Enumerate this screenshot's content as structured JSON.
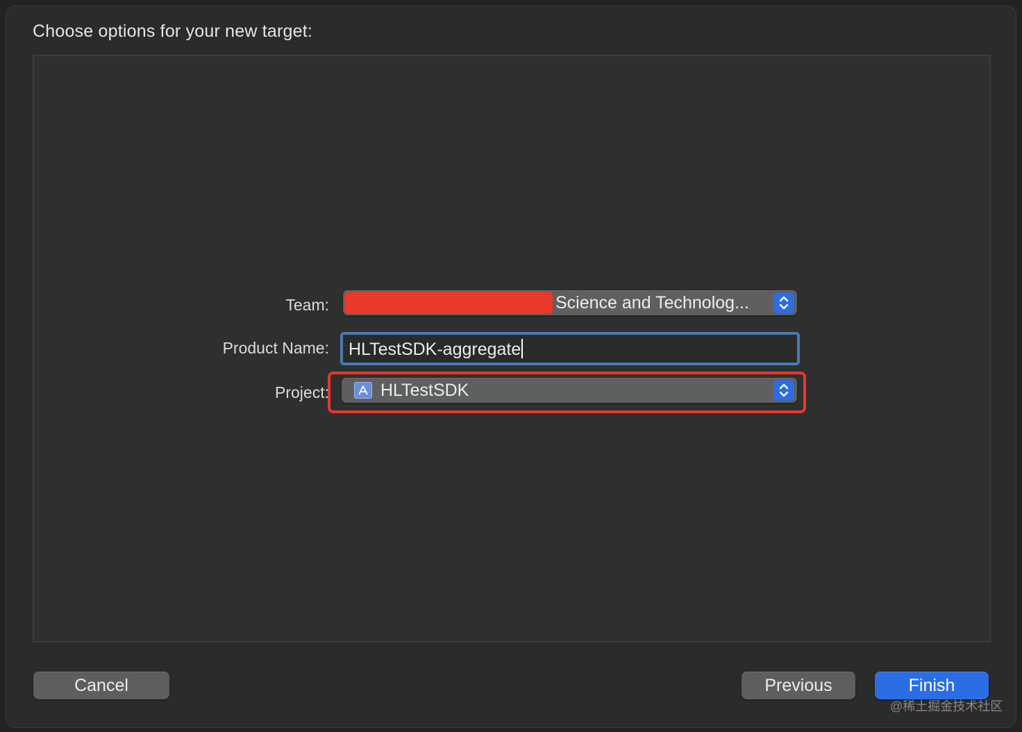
{
  "dialog": {
    "title": "Choose options for your new target:"
  },
  "form": {
    "team": {
      "label": "Team:",
      "value": "Science and Technolog..."
    },
    "product_name": {
      "label": "Product Name:",
      "value": "HLTestSDK-aggregate"
    },
    "project": {
      "label": "Project:",
      "value": "HLTestSDK"
    }
  },
  "buttons": {
    "cancel": "Cancel",
    "previous": "Previous",
    "finish": "Finish"
  },
  "watermark": "@稀土掘金技术社区",
  "colors": {
    "accent": "#2b6de4",
    "highlight_box": "#e8392a",
    "redaction": "#e8392a",
    "focus_ring": "#4a7ab0"
  },
  "icons": {
    "team_stepper": "chevron-up-down-icon",
    "project_stepper": "chevron-up-down-icon",
    "project_icon": "xcode-project-icon"
  }
}
